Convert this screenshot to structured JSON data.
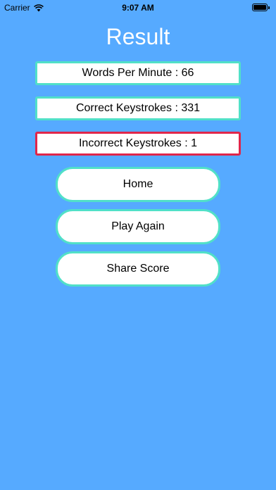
{
  "status_bar": {
    "carrier": "Carrier",
    "time": "9:07 AM",
    "battery_level": 1.0
  },
  "title": "Result",
  "stats": {
    "wpm": "Words Per Minute : 66",
    "correct": "Correct Keystrokes : 331",
    "incorrect": "Incorrect Keystrokes : 1"
  },
  "buttons": {
    "home": "Home",
    "play_again": "Play Again",
    "share_score": "Share Score"
  },
  "colors": {
    "background": "#56aaff",
    "accent_border": "#51e0c8",
    "error_border": "#e0264a"
  }
}
